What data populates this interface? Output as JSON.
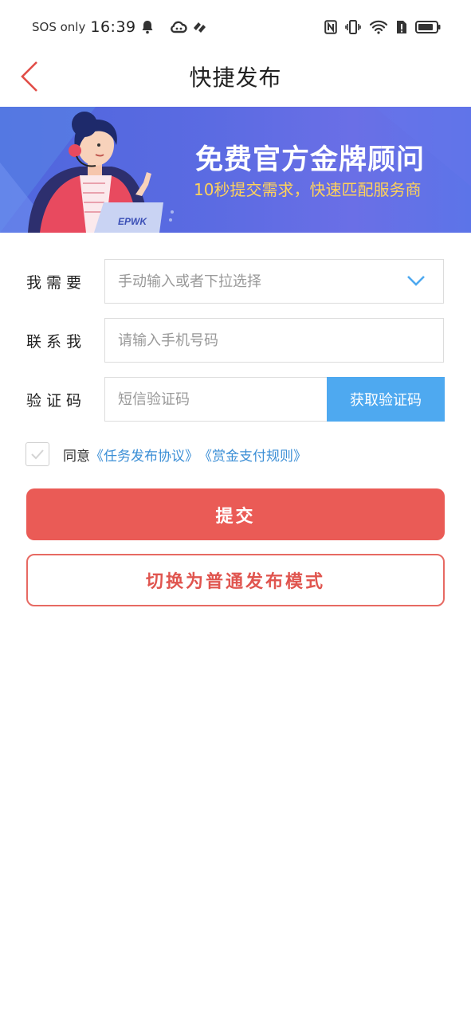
{
  "status_bar": {
    "carrier": "SOS only",
    "time": "16:39"
  },
  "header": {
    "title": "快捷发布"
  },
  "banner": {
    "title": "免费官方金牌顾问",
    "subtitle": "10秒提交需求，快速匹配服务商",
    "laptop_logo": "EPWK"
  },
  "form": {
    "need": {
      "label": "我需要",
      "placeholder": "手动输入或者下拉选择",
      "value": ""
    },
    "contact": {
      "label": "联系我",
      "placeholder": "请输入手机号码",
      "value": ""
    },
    "code": {
      "label": "验证码",
      "placeholder": "短信验证码",
      "value": "",
      "button": "获取验证码"
    }
  },
  "agreement": {
    "prefix": "同意",
    "link1": "《任务发布协议》",
    "link2": "《赏金支付规则》",
    "checked": false
  },
  "buttons": {
    "submit": "提交",
    "switch_mode": "切换为普通发布模式"
  },
  "colors": {
    "accent": "#ea5b56",
    "link": "#3c8fd6",
    "code_button": "#4ea9f0",
    "banner_bg": "#5b6be2",
    "banner_highlight": "#ffd25a"
  }
}
